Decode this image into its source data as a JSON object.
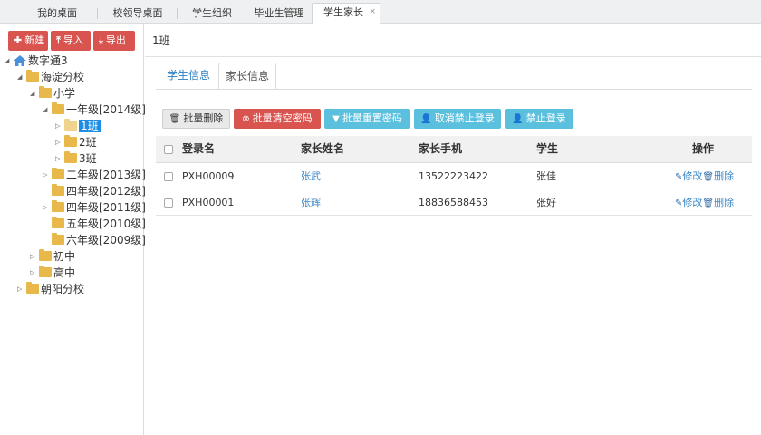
{
  "top_tabs": [
    {
      "label": "我的桌面"
    },
    {
      "label": "校领导桌面"
    },
    {
      "label": "学生组织"
    },
    {
      "label": "毕业生管理"
    },
    {
      "label": "学生家长",
      "active": true,
      "close": "×"
    }
  ],
  "toolbar": {
    "new_label": "新建",
    "import_label": "导入",
    "export_label": "导出"
  },
  "tree": {
    "root": "数字通3",
    "school1": "海淀分校",
    "primary": "小学",
    "grade1": "一年级[2014级]",
    "class1": "1班",
    "class2": "2班",
    "class3": "3班",
    "grade2": "二年级[2013级]",
    "grade4a": "四年级[2012级]",
    "grade4b": "四年级[2011级]",
    "grade5": "五年级[2010级]",
    "grade6": "六年级[2009级]",
    "junior": "初中",
    "senior": "高中",
    "school2": "朝阳分校"
  },
  "breadcrumb": "1班",
  "sub_tabs": {
    "student_info": "学生信息",
    "parent_info": "家长信息"
  },
  "actions": {
    "batch_delete": "批量删除",
    "batch_clear_password": "批量清空密码",
    "batch_reset_password": "批量重置密码",
    "cancel_ban_login": "取消禁止登录",
    "ban_login": "禁止登录"
  },
  "table": {
    "headers": {
      "login": "登录名",
      "parent_name": "家长姓名",
      "parent_phone": "家长手机",
      "student": "学生",
      "ops": "操作"
    },
    "rows": [
      {
        "login": "PXH00009",
        "parent_name": "张武",
        "parent_phone": "13522223422",
        "student": "张佳"
      },
      {
        "login": "PXH00001",
        "parent_name": "张辉",
        "parent_phone": "18836588453",
        "student": "张好"
      }
    ],
    "edit_label": "修改",
    "delete_label": "删除"
  },
  "colors": {
    "danger": "#d9534f",
    "info": "#5bc0de",
    "link": "#3a87c8",
    "selection": "#1e8ee5",
    "folder": "#e8b94a"
  }
}
